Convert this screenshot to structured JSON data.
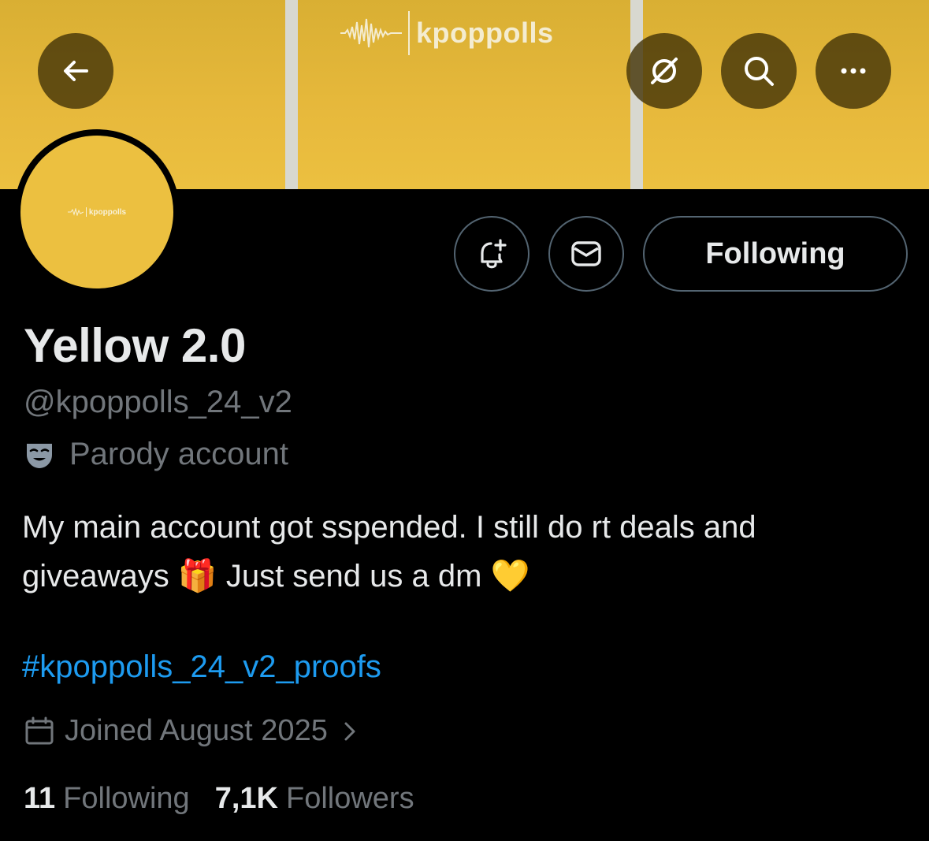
{
  "banner": {
    "wordmark": "kpoppolls"
  },
  "header": {
    "back_icon": "arrow-left-icon",
    "grok_icon": "grok-icon",
    "search_icon": "search-icon",
    "more_icon": "more-horizontal-icon"
  },
  "avatar": {
    "wordmark": "kpoppolls"
  },
  "actions": {
    "notify_icon": "bell-plus-icon",
    "dm_icon": "envelope-icon",
    "following_label": "Following"
  },
  "profile": {
    "display_name": "Yellow 2.0",
    "handle": "@kpoppolls_24_v2",
    "account_label": "Parody account",
    "bio_line1": "My main account got sspended. I still do rt deals and",
    "bio_line2_a": "giveaways",
    "bio_emoji_gift": "🎁",
    "bio_line2_b": "Just send us a dm",
    "bio_emoji_heart": "💛",
    "hashtag": "#kpoppolls_24_v2_proofs",
    "joined": "Joined August 2025"
  },
  "stats": {
    "following_count": "11",
    "following_label": "Following",
    "followers_count": "7,1K",
    "followers_label": "Followers"
  },
  "colors": {
    "banner": "#e7b93c",
    "link": "#1d9bf0",
    "secondary_text": "#71767b",
    "background": "#000000"
  }
}
